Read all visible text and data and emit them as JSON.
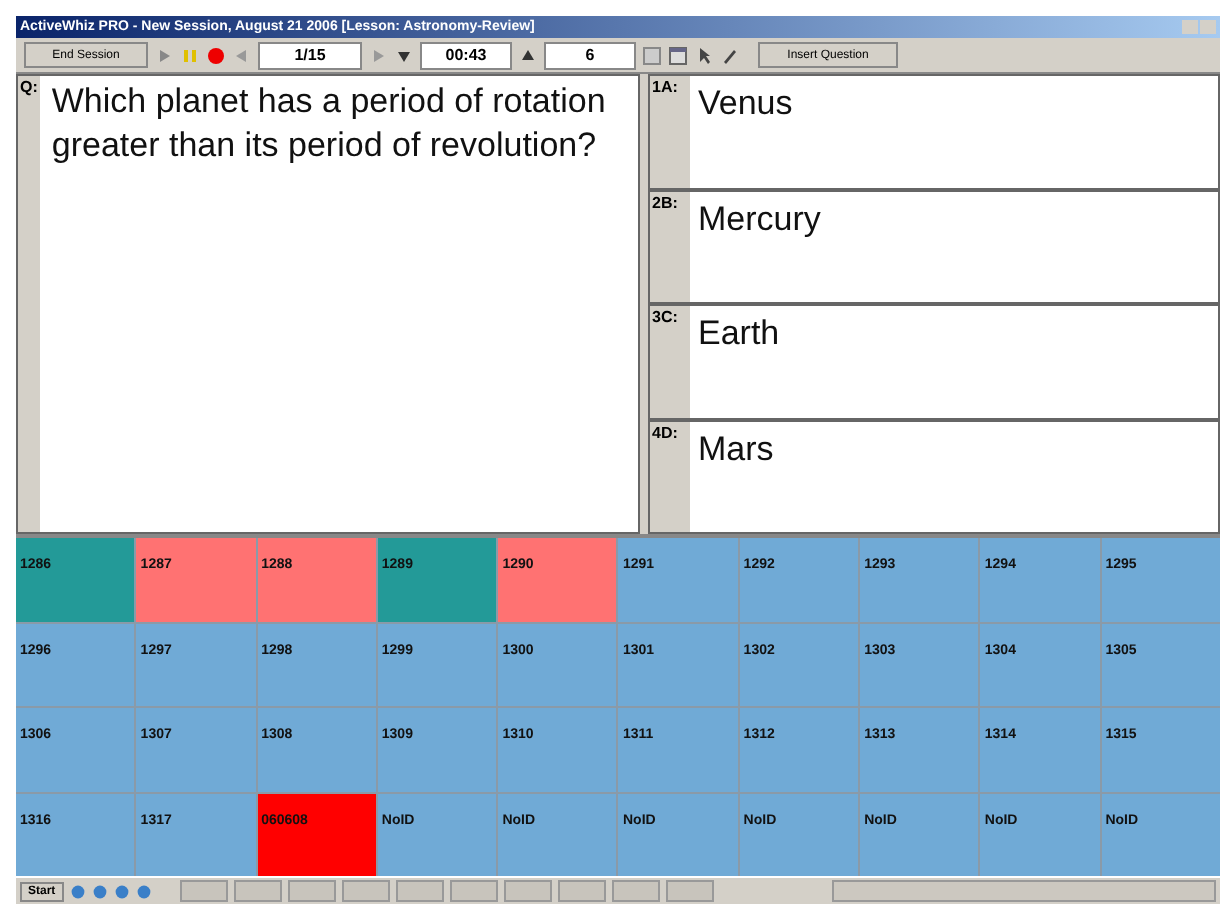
{
  "window": {
    "title": "ActiveWhiz PRO - New Session, August 21 2006 [Lesson: Astronomy-Review]"
  },
  "toolbar": {
    "end_session": "End Session",
    "question_counter": "1/15",
    "timer": "00:43",
    "responses": "6",
    "insert_question": "Insert Question"
  },
  "question": {
    "label": "Q:",
    "text": "Which planet has a period of rotation greater than its period of revolution?"
  },
  "answers": [
    {
      "label": "1A:",
      "text": "Venus"
    },
    {
      "label": "2B:",
      "text": "Mercury"
    },
    {
      "label": "3C:",
      "text": "Earth"
    },
    {
      "label": "4D:",
      "text": "Mars"
    }
  ],
  "clickers": [
    {
      "id": "1286",
      "color": "#239a98"
    },
    {
      "id": "1287",
      "color": "#ff7272"
    },
    {
      "id": "1288",
      "color": "#ff7272"
    },
    {
      "id": "1289",
      "color": "#239a98"
    },
    {
      "id": "1290",
      "color": "#ff7272"
    },
    {
      "id": "1291",
      "color": "#70aad6"
    },
    {
      "id": "1292",
      "color": "#70aad6"
    },
    {
      "id": "1293",
      "color": "#70aad6"
    },
    {
      "id": "1294",
      "color": "#70aad6"
    },
    {
      "id": "1295",
      "color": "#70aad6"
    },
    {
      "id": "1296",
      "color": "#70aad6"
    },
    {
      "id": "1297",
      "color": "#70aad6"
    },
    {
      "id": "1298",
      "color": "#70aad6"
    },
    {
      "id": "1299",
      "color": "#70aad6"
    },
    {
      "id": "1300",
      "color": "#70aad6"
    },
    {
      "id": "1301",
      "color": "#70aad6"
    },
    {
      "id": "1302",
      "color": "#70aad6"
    },
    {
      "id": "1303",
      "color": "#70aad6"
    },
    {
      "id": "1304",
      "color": "#70aad6"
    },
    {
      "id": "1305",
      "color": "#70aad6"
    },
    {
      "id": "1306",
      "color": "#70aad6"
    },
    {
      "id": "1307",
      "color": "#70aad6"
    },
    {
      "id": "1308",
      "color": "#70aad6"
    },
    {
      "id": "1309",
      "color": "#70aad6"
    },
    {
      "id": "1310",
      "color": "#70aad6"
    },
    {
      "id": "1311",
      "color": "#70aad6"
    },
    {
      "id": "1312",
      "color": "#70aad6"
    },
    {
      "id": "1313",
      "color": "#70aad6"
    },
    {
      "id": "1314",
      "color": "#70aad6"
    },
    {
      "id": "1315",
      "color": "#70aad6"
    },
    {
      "id": "1316",
      "color": "#70aad6"
    },
    {
      "id": "1317",
      "color": "#70aad6"
    },
    {
      "id": "060608",
      "color": "#ff0000"
    },
    {
      "id": "NoID",
      "color": "#70aad6"
    },
    {
      "id": "NoID",
      "color": "#70aad6"
    },
    {
      "id": "NoID",
      "color": "#70aad6"
    },
    {
      "id": "NoID",
      "color": "#70aad6"
    },
    {
      "id": "NoID",
      "color": "#70aad6"
    },
    {
      "id": "NoID",
      "color": "#70aad6"
    },
    {
      "id": "NoID",
      "color": "#70aad6"
    }
  ],
  "taskbar": {
    "start": "Start"
  }
}
